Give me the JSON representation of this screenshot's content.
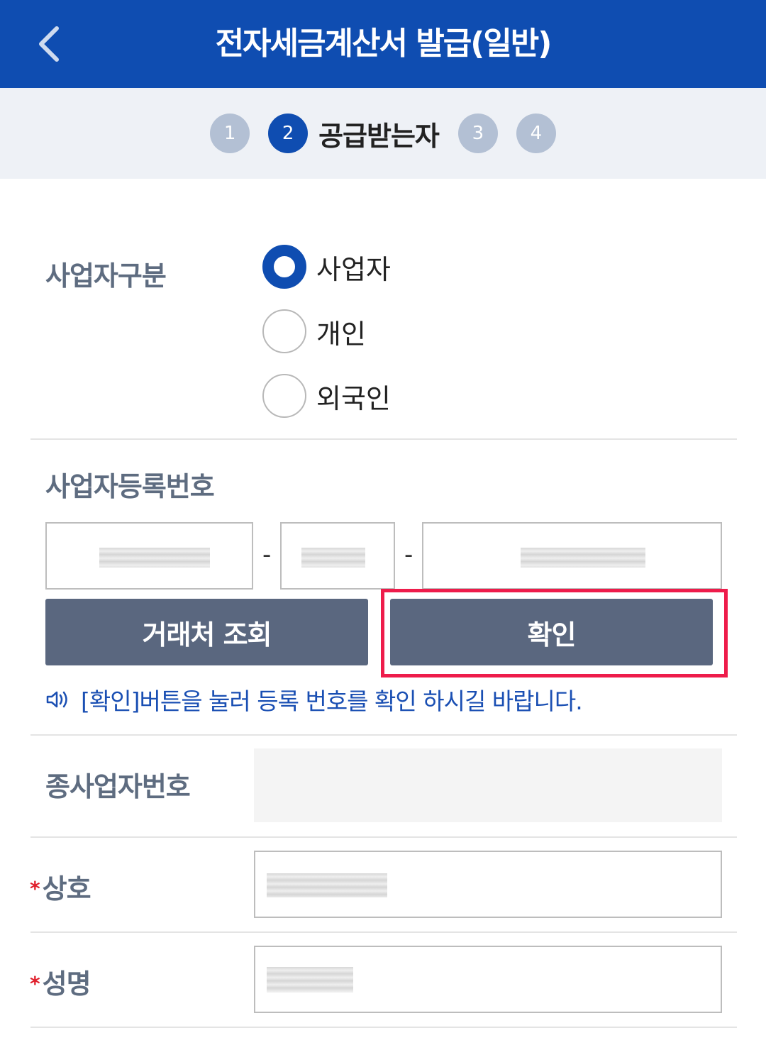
{
  "header": {
    "title": "전자세금계산서 발급(일반)",
    "back_icon": "chevron-left-icon"
  },
  "steps": {
    "s1": "1",
    "s2": "2",
    "s2_label": "공급받는자",
    "s3": "3",
    "s4": "4"
  },
  "business_type": {
    "label": "사업자구분",
    "options": [
      "사업자",
      "개인",
      "외국인"
    ],
    "selected": "사업자"
  },
  "reg_number": {
    "label": "사업자등록번호",
    "separator": "-",
    "search_button": "거래처 조회",
    "confirm_button": "확인",
    "notice": "[확인]버튼을 눌러 등록 번호를 확인 하시길 바랍니다."
  },
  "sub_business": {
    "label": "종사업자번호"
  },
  "company": {
    "label": "상호",
    "required_mark": "*"
  },
  "name": {
    "label": "성명",
    "required_mark": "*"
  },
  "colors": {
    "primary": "#0f4db1",
    "button": "#5a677f",
    "highlight": "#ee1c4b",
    "required": "#e01f2b",
    "notice": "#1a4fb3"
  }
}
